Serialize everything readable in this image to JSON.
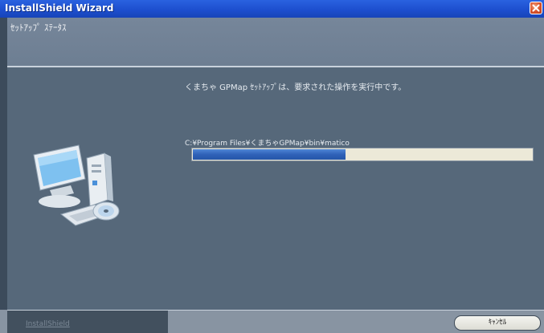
{
  "window": {
    "title": "InstallShield Wizard"
  },
  "header": {
    "title": "ｾｯﾄｱｯﾌﾟ ｽﾃｰﾀｽ"
  },
  "main": {
    "status_message": "くまちゃ GPMap ｾｯﾄｱｯﾌﾟは、要求された操作を実行中です。",
    "current_file": "C:¥Program Files¥くまちゃGPMap¥bin¥matico",
    "progress_percent": 45
  },
  "footer": {
    "brand": "InstallShield",
    "cancel_label": "ｷｬﾝｾﾙ"
  },
  "icons": [
    "close-icon",
    "computer-install-icon"
  ],
  "colors": {
    "titlebar": "#1d4fcf",
    "progress_fill": "#2f62b8",
    "background": "#56687a"
  }
}
